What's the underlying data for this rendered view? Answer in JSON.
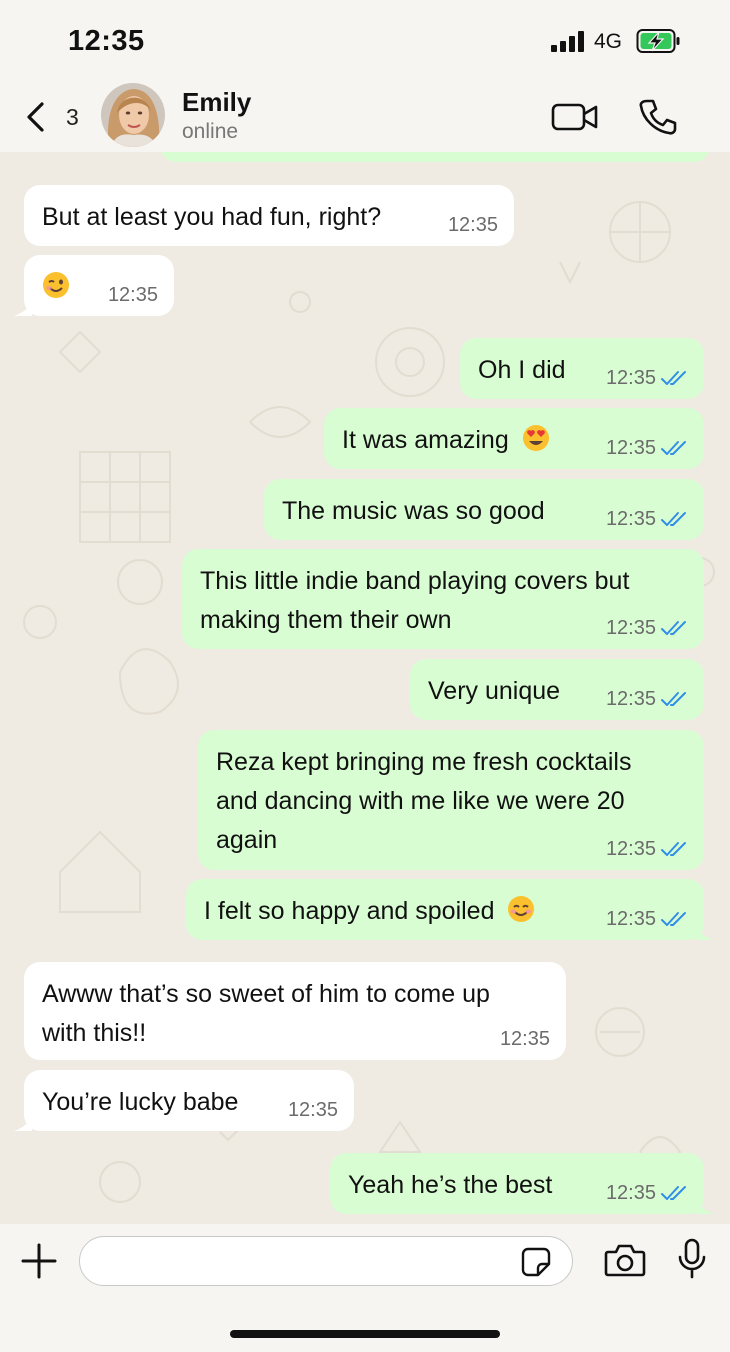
{
  "status_bar": {
    "time": "12:35",
    "network": "4G",
    "battery_charging": true
  },
  "header": {
    "back_count": "3",
    "contact_name": "Emily",
    "contact_status": "online"
  },
  "messages": [
    {
      "direction": "in",
      "text": "But at least you had fun, right?",
      "time": "12:35"
    },
    {
      "direction": "in",
      "text": "",
      "emoji": "winking-face-emoji",
      "time": "12:35"
    },
    {
      "direction": "out",
      "text": "Oh I did",
      "time": "12:35",
      "read": true
    },
    {
      "direction": "out",
      "text": "It was amazing",
      "emoji": "heart-eyes-emoji",
      "time": "12:35",
      "read": true
    },
    {
      "direction": "out",
      "text": "The music was so good",
      "time": "12:35",
      "read": true
    },
    {
      "direction": "out",
      "lines": [
        "This little indie band playing covers but",
        "making them their own"
      ],
      "time": "12:35",
      "read": true
    },
    {
      "direction": "out",
      "text": "Very unique",
      "time": "12:35",
      "read": true
    },
    {
      "direction": "out",
      "lines": [
        "Reza kept bringing me fresh cocktails",
        "and dancing with me like we were 20",
        "again"
      ],
      "time": "12:35",
      "read": true
    },
    {
      "direction": "out",
      "text": "I felt so happy and spoiled",
      "emoji": "smiling-face-emoji",
      "time": "12:35",
      "read": true
    },
    {
      "direction": "in",
      "lines": [
        "Awww that’s so sweet of him to come up",
        "with this!!"
      ],
      "time": "12:35"
    },
    {
      "direction": "in",
      "text": "You’re lucky babe",
      "time": "12:35"
    },
    {
      "direction": "out",
      "text": "Yeah he’s the best",
      "time": "12:35",
      "read": true
    }
  ],
  "composer": {
    "input_value": "",
    "placeholder": ""
  },
  "colors": {
    "incoming_bubble": "#ffffff",
    "outgoing_bubble": "#d9fdd3",
    "read_receipt": "#53bdeb",
    "background": "#f6f5f2"
  }
}
